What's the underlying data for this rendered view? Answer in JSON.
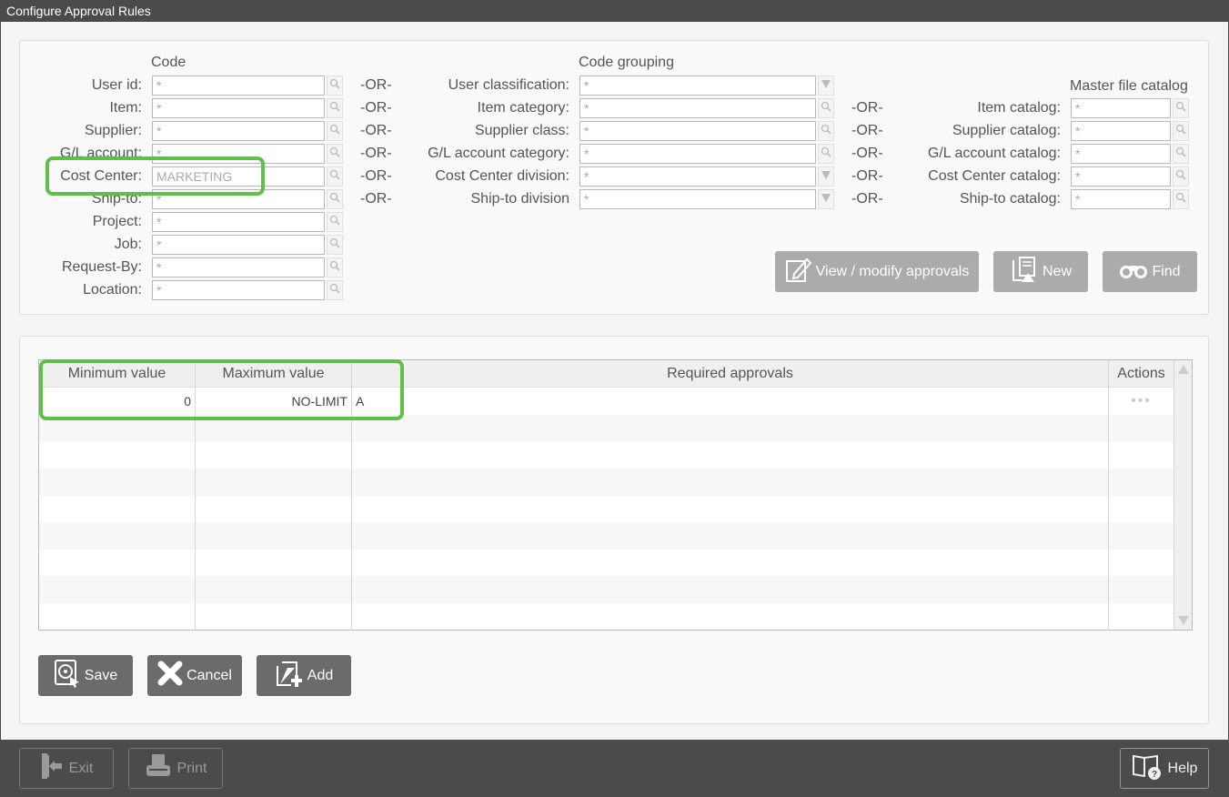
{
  "window": {
    "title": "Configure Approval Rules"
  },
  "code_section": {
    "header": "Code",
    "fields": [
      {
        "label": "User id:",
        "value": "*",
        "or": "-OR-"
      },
      {
        "label": "Item:",
        "value": "*",
        "or": "-OR-"
      },
      {
        "label": "Supplier:",
        "value": "*",
        "or": "-OR-"
      },
      {
        "label": "G/L account:",
        "value": "*",
        "or": "-OR-"
      },
      {
        "label": "Cost Center:",
        "value": "MARKETING",
        "or": "-OR-"
      },
      {
        "label": "Ship-to:",
        "value": "*",
        "or": "-OR-"
      },
      {
        "label": "Project:",
        "value": "*"
      },
      {
        "label": "Job:",
        "value": "*"
      },
      {
        "label": "Request-By:",
        "value": "*"
      },
      {
        "label": "Location:",
        "value": "*"
      }
    ]
  },
  "grouping_section": {
    "header": "Code grouping",
    "fields": [
      {
        "label": "User classification:",
        "value": "*",
        "button": "dropdown"
      },
      {
        "label": "Item category:",
        "value": "*",
        "button": "search",
        "or": "-OR-"
      },
      {
        "label": "Supplier class:",
        "value": "*",
        "button": "search",
        "or": "-OR-"
      },
      {
        "label": "G/L account category:",
        "value": "*",
        "button": "search",
        "or": "-OR-"
      },
      {
        "label": "Cost Center division:",
        "value": "*",
        "button": "dropdown",
        "or": "-OR-"
      },
      {
        "label": "Ship-to division",
        "value": "*",
        "button": "dropdown",
        "or": "-OR-"
      }
    ]
  },
  "catalog_section": {
    "header": "Master file catalog",
    "fields": [
      {
        "label": "Item catalog:",
        "value": "*"
      },
      {
        "label": "Supplier catalog:",
        "value": "*"
      },
      {
        "label": "G/L account catalog:",
        "value": "*"
      },
      {
        "label": "Cost Center catalog:",
        "value": "*"
      },
      {
        "label": "Ship-to catalog:",
        "value": "*"
      }
    ]
  },
  "actions": {
    "view_modify": "View / modify approvals",
    "new": "New",
    "find": "Find"
  },
  "grid": {
    "columns": [
      "Minimum value",
      "Maximum value",
      "Required approvals",
      "Actions"
    ],
    "rows": [
      {
        "min": "0",
        "max": "NO-LIMIT",
        "approvals": "A",
        "actions": "•••"
      }
    ]
  },
  "bottom_buttons": {
    "save": "Save",
    "cancel": "Cancel",
    "add": "Add"
  },
  "footer": {
    "exit": "Exit",
    "print": "Print",
    "help": "Help"
  },
  "colors": {
    "highlight": "#5fbf4a",
    "titlebar": "#4b4b4b",
    "button_dark": "#6b6b6b",
    "button_light": "#ababab"
  }
}
